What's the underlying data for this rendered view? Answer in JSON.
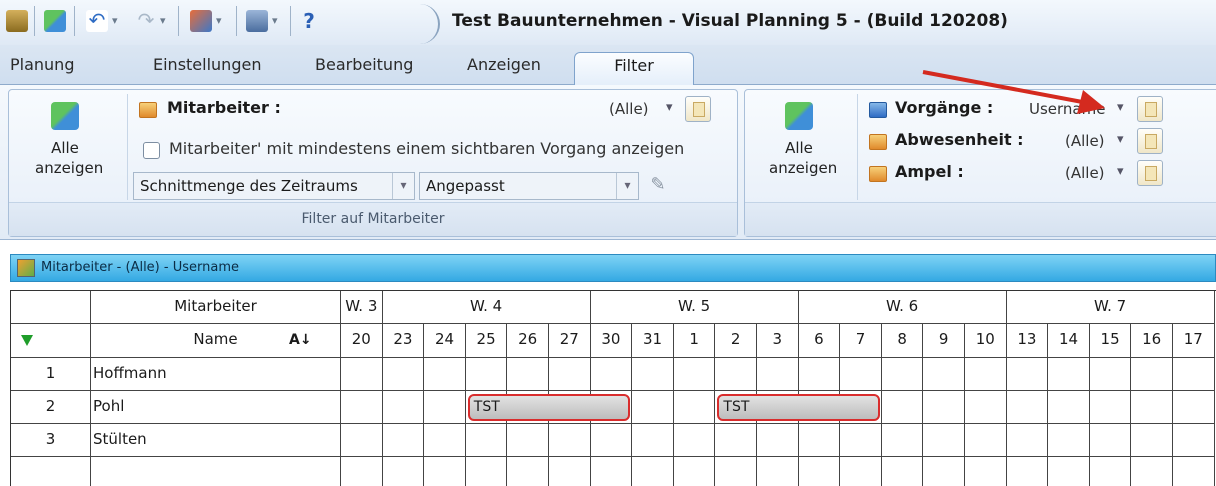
{
  "window": {
    "title": "Test Bauunternehmen - Visual Planning 5 - (Build 120208)"
  },
  "tabs": [
    "Planung",
    "Einstellungen",
    "Bearbeitung",
    "Anzeigen",
    "Filter"
  ],
  "ribbon": {
    "group1": {
      "show_all": "Alle anzeigen",
      "filter_label": "Mitarbeiter :",
      "filter_value": "(Alle)",
      "checkbox_label": "Mitarbeiter' mit mindestens einem sichtbaren Vorgang anzeigen",
      "combo1": "Schnittmenge des Zeitraums",
      "combo2": "Angepasst",
      "group_label": "Filter auf Mitarbeiter"
    },
    "group2": {
      "show_all": "Alle anzeigen",
      "f1_label": "Vorgänge :",
      "f1_value": "Username",
      "f2_label": "Abwesenheit :",
      "f2_value": "(Alle)",
      "f3_label": "Ampel :",
      "f3_value": "(Alle)"
    }
  },
  "view": {
    "title": "Mitarbeiter - (Alle) - Username"
  },
  "grid": {
    "header_group": "Mitarbeiter",
    "header_name": "Name",
    "weeks": [
      "W. 3",
      "W. 4",
      "W. 5",
      "W. 6",
      "W. 7"
    ],
    "days": [
      "20",
      "23",
      "24",
      "25",
      "26",
      "27",
      "30",
      "31",
      "1",
      "2",
      "3",
      "6",
      "7",
      "8",
      "9",
      "10",
      "13",
      "14",
      "15",
      "16",
      "17"
    ],
    "rows": [
      {
        "num": "1",
        "name": "Hoffmann"
      },
      {
        "num": "2",
        "name": "Pohl"
      },
      {
        "num": "3",
        "name": "Stülten"
      }
    ],
    "bars": [
      {
        "row": 1,
        "from": 3,
        "to": 7,
        "label": "TST"
      },
      {
        "row": 1,
        "from": 9,
        "to": 13,
        "label": "TST"
      }
    ]
  },
  "colors": {
    "accent": "#34a9e3",
    "bar_border": "#d92d2d",
    "ribbon": "#e2ebf6"
  }
}
